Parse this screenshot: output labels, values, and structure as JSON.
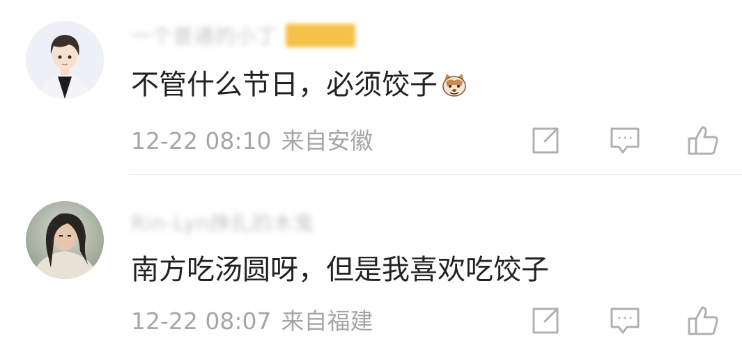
{
  "comments": [
    {
      "username": "一个普通的小丁",
      "text": "不管什么节日，必须饺子",
      "emoji": "cat-face-icon",
      "time": "12-22 08:10",
      "location": "来自安徽"
    },
    {
      "username": "Rin-Lyn挣扎的木鬼",
      "text": "南方吃汤圆呀，但是我喜欢吃饺子",
      "time": "12-22 08:07",
      "location": "来自福建"
    }
  ],
  "icons": {
    "share": "share-icon",
    "comment": "comment-icon",
    "like": "thumbs-up-icon"
  },
  "colors": {
    "text": "#222222",
    "meta": "#a6a6a6",
    "icon": "#b0b0b0",
    "badge": "#f6c24a",
    "divider": "#e6e6e6"
  }
}
